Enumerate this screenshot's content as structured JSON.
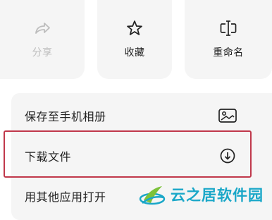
{
  "actions": [
    {
      "label": "分享",
      "icon": "share-icon",
      "enabled": false
    },
    {
      "label": "收藏",
      "icon": "star-icon",
      "enabled": true
    },
    {
      "label": "重命名",
      "icon": "rename-icon",
      "enabled": true
    }
  ],
  "menu": [
    {
      "label": "保存至手机相册",
      "icon": "image-icon"
    },
    {
      "label": "下载文件",
      "icon": "download-icon"
    },
    {
      "label": "用其他应用打开",
      "icon": ""
    }
  ],
  "highlighted_item": "下载文件",
  "watermark": {
    "text": "云之居软件园"
  },
  "colors": {
    "highlight": "#c0384b",
    "watermark": "#1aa7c8",
    "card": "#f5f5f5",
    "disabled": "#bdbdbd"
  }
}
